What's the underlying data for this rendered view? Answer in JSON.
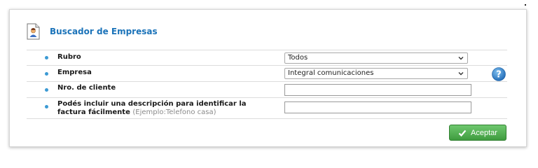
{
  "header": {
    "title": "Buscador de Empresas",
    "icon": "document-user-icon"
  },
  "form": {
    "rubro": {
      "label": "Rubro",
      "value": "Todos"
    },
    "empresa": {
      "label": "Empresa",
      "value": "Integral comunicaciones"
    },
    "cliente": {
      "label": "Nro. de cliente",
      "value": ""
    },
    "descripcion": {
      "label_line1": "Podés incluir una descripción para identificar la",
      "label_line2": "factura fácilmente",
      "hint": "(Ejemplo:Telefono casa)",
      "value": ""
    }
  },
  "actions": {
    "accept_label": "Aceptar"
  },
  "colors": {
    "title": "#1b73b9",
    "bullet": "#3c9ad4",
    "accept": "#4cae4c",
    "help": "#2a7fc9"
  }
}
